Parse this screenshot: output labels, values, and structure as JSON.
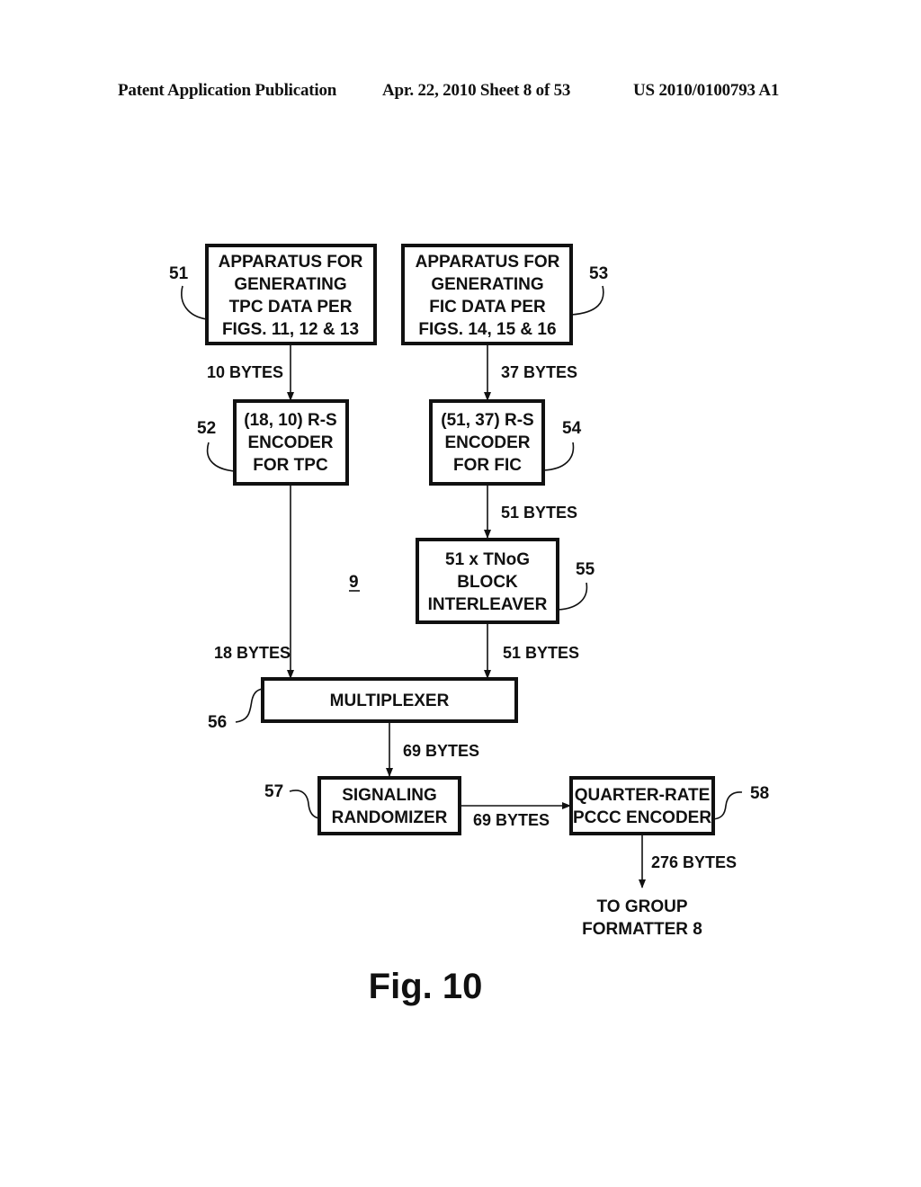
{
  "header": {
    "left": "Patent Application Publication",
    "middle": "Apr. 22, 2010  Sheet 8 of 53",
    "right": "US 2010/0100793 A1"
  },
  "figure": {
    "caption": "Fig. 10",
    "system_ref": "9",
    "blocks": {
      "b51": {
        "ref": "51",
        "lines": [
          "APPARATUS FOR",
          "GENERATING",
          "TPC DATA PER",
          "FIGS. 11, 12 & 13"
        ]
      },
      "b53": {
        "ref": "53",
        "lines": [
          "APPARATUS FOR",
          "GENERATING",
          "FIC DATA PER",
          "FIGS. 14, 15 & 16"
        ]
      },
      "b52": {
        "ref": "52",
        "lines": [
          "(18, 10) R-S",
          "ENCODER",
          "FOR TPC"
        ]
      },
      "b54": {
        "ref": "54",
        "lines": [
          "(51, 37) R-S",
          "ENCODER",
          "FOR FIC"
        ]
      },
      "b55": {
        "ref": "55",
        "lines": [
          "51 x TNoG",
          "BLOCK",
          "INTERLEAVER"
        ]
      },
      "b56": {
        "ref": "56",
        "lines": [
          "MULTIPLEXER"
        ]
      },
      "b57": {
        "ref": "57",
        "lines": [
          "SIGNALING",
          "RANDOMIZER"
        ]
      },
      "b58": {
        "ref": "58",
        "lines": [
          "QUARTER-RATE",
          "PCCC ENCODER"
        ]
      }
    },
    "edges": {
      "e51_52": "10 BYTES",
      "e53_54": "37 BYTES",
      "e54_55": "51 BYTES",
      "e52_56": "18 BYTES",
      "e55_56": "51 BYTES",
      "e56_57": "69 BYTES",
      "e57_58": "69 BYTES",
      "e58_out": "276 BYTES"
    },
    "output_lines": [
      "TO GROUP",
      "FORMATTER 8"
    ]
  }
}
